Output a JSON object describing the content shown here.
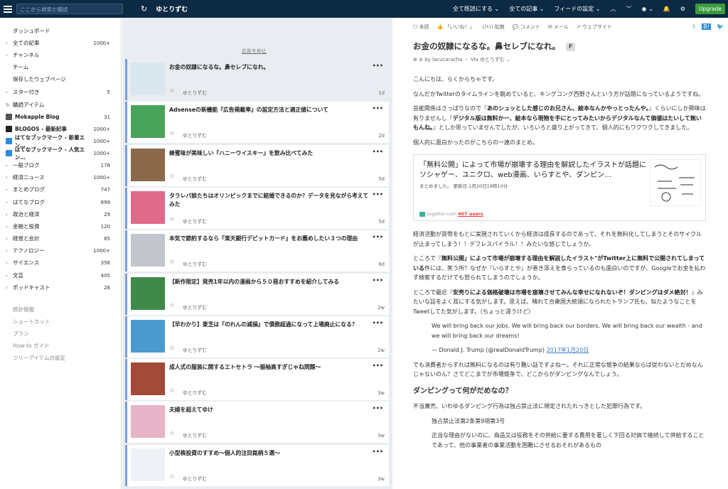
{
  "topbar": {
    "search_placeholder": "ここから検索か購読",
    "feed_title": "ゆとりずむ",
    "mark_all_read": "全て既読にする",
    "all_articles": "全ての記事",
    "feed_settings": "フィードの設定",
    "upgrade": "Upgrade"
  },
  "sidebar": {
    "items": [
      {
        "label": "ダッシュボード",
        "count": "",
        "chev": false
      },
      {
        "label": "全ての記事",
        "count": "1000+",
        "chev": true
      },
      {
        "label": "チャンネル",
        "count": "",
        "chev": true
      },
      {
        "label": "チーム",
        "count": "",
        "chev": false
      },
      {
        "label": "保存したウェブページ",
        "count": "",
        "chev": false
      },
      {
        "label": "スター付き",
        "count": "5",
        "chev": true
      }
    ],
    "subscriptions_label": "購読アイテム",
    "feeds": [
      {
        "label": "Mokapple Blog",
        "count": "31",
        "icon": "rss-icon"
      },
      {
        "label": "BLOGOS - 最新記事",
        "count": "1000+",
        "icon": "blogos-icon"
      },
      {
        "label": "はてなブックマーク - 新着エン…",
        "count": "1000+",
        "icon": "hatena-icon"
      },
      {
        "label": "はてなブックマーク - 人気エン…",
        "count": "1000+",
        "icon": "hatena-icon"
      }
    ],
    "folders": [
      {
        "label": "一般ブログ",
        "count": "178"
      },
      {
        "label": "経済ニュース",
        "count": "1000+"
      },
      {
        "label": "まとめブログ",
        "count": "747"
      },
      {
        "label": "はてなブログ",
        "count": "699"
      },
      {
        "label": "政治と経済",
        "count": "29"
      },
      {
        "label": "金融と投資",
        "count": "120"
      },
      {
        "label": "経営と会計",
        "count": "85"
      },
      {
        "label": "テクノロジー",
        "count": "1000+"
      },
      {
        "label": "サイエンス",
        "count": "356"
      },
      {
        "label": "文芸",
        "count": "405"
      },
      {
        "label": "ポッドキャスト",
        "count": "26"
      }
    ],
    "footer": [
      "統計情報",
      "ショートカット",
      "プラン",
      "How-to ガイド",
      "ツリーアイテムの設定"
    ]
  },
  "list": {
    "ad_label": "広告を抑止",
    "cards": [
      {
        "title": "お金の奴隷になるな。鼻セレブになれ。",
        "source": "ゆとりずむ",
        "age": "1d",
        "thumb": "#dbe7ef"
      },
      {
        "title": "Adsenseの新機能『広告掲載率』の設定方法と適正値について",
        "source": "ゆとりずむ",
        "age": "2d",
        "thumb": "#4aa35a"
      },
      {
        "title": "蜂蜜味が美味しい『ハニーウイスキー』を飲み比べてみた",
        "source": "ゆとりずむ",
        "age": "5d",
        "thumb": "#8a6a4a"
      },
      {
        "title": "タラレバ娘たちはオリンピックまでに結婚できるのか？データを見ながら考えてみた",
        "source": "ゆとりずむ",
        "age": "5d",
        "thumb": "#e06a8a"
      },
      {
        "title": "本気で節約するなら『楽天銀行デビットカード』をお薦めしたい３つの理由",
        "source": "ゆとりずむ",
        "age": "6d",
        "thumb": "#c2c6cc"
      },
      {
        "title": "【新作限定】発売1年以内の漫画から５０冊おすすめを紹介してみる",
        "source": "ゆとりずむ",
        "age": "2w",
        "thumb": "#3f8a4a"
      },
      {
        "title": "【早わかり】東芝は『のれんの減損』で債務超過になって上場廃止になる？",
        "source": "ゆとりずむ",
        "age": "2w",
        "thumb": "#4a9ad0"
      },
      {
        "title": "成人式の服装に関するエトセトラ 〜振袖高すぎじゃね問題〜",
        "source": "ゆとりずむ",
        "age": "3w",
        "thumb": "#a34a3a"
      },
      {
        "title": "夫婦を超えてゆけ",
        "source": "ゆとりずむ",
        "age": "3w",
        "thumb": "#e8b4c8"
      },
      {
        "title": "小型株投資のすすめ〜個人的注目銘柄５選〜",
        "source": "ゆとりずむ",
        "age": "3w",
        "thumb": "#eef2f6"
      }
    ]
  },
  "reader": {
    "toolbar": [
      "未読",
      "「いいね！」",
      "拡散",
      "コメント",
      "メール",
      "ウェブサイト"
    ],
    "title": "お金の奴隷になるな。鼻セレブになれ。",
    "badge": "F",
    "meta": "by lacucaracha ・ Via ゆとりずむ",
    "p1": "こんにちは、らくからちゃです。",
    "p2": "なんだかTwitterのタイムラインを眺めていると、キングコング西野さんという方が話題になっているようですね。",
    "p3a": "芸能関係はさっぱりなので『",
    "p3b": "あのシュッとした感じのお兄さん、絵本なんかやっとったんや。",
    "p3c": "』くらいにしか興味は有りませんし『",
    "p3d": "デジタル版は無料かー、絵本なら現物を手にとってみたいからデジタルなんて価値はたいして無いもんね。",
    "p3e": "』としか思っていませんでしたが、いろいろと盛り上がってきて、個人的にもワクワクしてきました。",
    "p4": "個人的に面白かったのがこちらの一連のまとめ。",
    "embed_title": "「無料公開」によって市場が崩壊する理由を解説したイラストが話題に　ソシャゲー、ユニクロ、web漫画、いらすとや、ダンピン…",
    "embed_sub": "まとめました。 更新日:1月20日19時10分",
    "embed_site": "togetter.com",
    "embed_users": "407 users",
    "p5": "経済活動が貨幣をもとに実現されていくから経済は成長するのであって、それを無料化してしまうとそのサイクルが止まってしまう！！デフレスパイラル！！みたいな感じでしょうか。",
    "p6a": "ところで『",
    "p6b": "無料公開」によって市場が崩壊する理由を解説したイラスト\"がTwitter上に無料で公開されてしまっている",
    "p6c": "件には、笑う所？なぜか『いらすとや』が巻き添えを食らっているのも面白いのですが、Googleでお金を払わず検索するだけでも怒られてしまうのでしょうか。",
    "p7a": "ところで最近『",
    "p7b": "安売りによる価格破壊は市場を崩壊させてみんな幸せになれないぞ！ダンピングはダメ絶対！",
    "p7c": "』みたいな話をよく耳にする気がします。思えば、晴れて合衆国大統領になられたトランプ氏も、似たようなことをTweetしてた気がします。（ちょっと違うけど）",
    "quote": "We will bring back our jobs. We will bring back our borders. We will bring back our wealth - and we will bring back our dreams!",
    "quote_by": "— Donald J. Trump (@realDonaldTrump) ",
    "quote_date": "2017年1月20日",
    "p8": "でも消費者からすれば無料になるのは有り難い話ですよねー。それに正常な競争の結果ならば従わないとだめなんじゃないのん？さてどこまでが市場競争で、どこからがダンピングなんでしょう。",
    "h2": "ダンピングって何がだめなの？",
    "p9": "不当廉売、いわゆるダンピング行為は独占禁止法に規定されたれっきとした犯罪行為です。",
    "p10": "独占禁止法第2条第9項第3号",
    "p11": "正当な理由がないのに、商品又は役務をその供給に要する費用を著しく下回る対価で継続して供給することであって、他の事業者の事業活動を困難にさせるおそれがあるもの"
  }
}
